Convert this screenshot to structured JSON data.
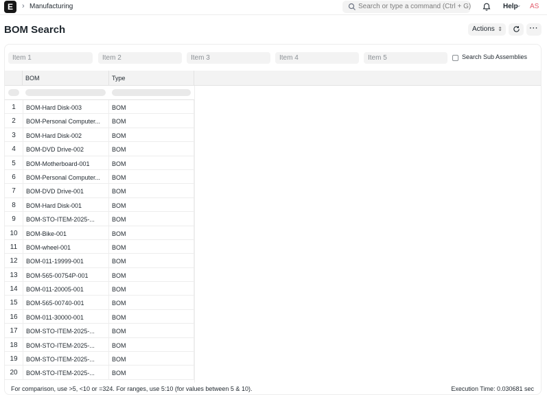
{
  "navbar": {
    "logo": "E",
    "breadcrumb": "Manufacturing",
    "search_placeholder": "Search or type a command (Ctrl + G)",
    "help_label": "Help",
    "avatar_initials": "AS"
  },
  "page": {
    "title": "BOM Search",
    "actions_label": "Actions",
    "refresh_icon": "refresh-icon",
    "more_label": "···"
  },
  "filters": {
    "item1": "Item 1",
    "item2": "Item 2",
    "item3": "Item 3",
    "item4": "Item 4",
    "item5": "Item 5",
    "search_sub_assemblies": "Search Sub Assemblies",
    "search_sub_assemblies_checked": false
  },
  "table": {
    "columns": [
      "BOM",
      "Type"
    ],
    "rows": [
      {
        "no": "1",
        "bom": "BOM-Hard Disk-003",
        "type": "BOM"
      },
      {
        "no": "2",
        "bom": "BOM-Personal Computer...",
        "type": "BOM"
      },
      {
        "no": "3",
        "bom": "BOM-Hard Disk-002",
        "type": "BOM"
      },
      {
        "no": "4",
        "bom": "BOM-DVD Drive-002",
        "type": "BOM"
      },
      {
        "no": "5",
        "bom": "BOM-Motherboard-001",
        "type": "BOM"
      },
      {
        "no": "6",
        "bom": "BOM-Personal Computer...",
        "type": "BOM"
      },
      {
        "no": "7",
        "bom": "BOM-DVD Drive-001",
        "type": "BOM"
      },
      {
        "no": "8",
        "bom": "BOM-Hard Disk-001",
        "type": "BOM"
      },
      {
        "no": "9",
        "bom": "BOM-STO-ITEM-2025-...",
        "type": "BOM"
      },
      {
        "no": "10",
        "bom": "BOM-Bike-001",
        "type": "BOM"
      },
      {
        "no": "11",
        "bom": "BOM-wheel-001",
        "type": "BOM"
      },
      {
        "no": "12",
        "bom": "BOM-011-19999-001",
        "type": "BOM"
      },
      {
        "no": "13",
        "bom": "BOM-565-00754P-001",
        "type": "BOM"
      },
      {
        "no": "14",
        "bom": "BOM-011-20005-001",
        "type": "BOM"
      },
      {
        "no": "15",
        "bom": "BOM-565-00740-001",
        "type": "BOM"
      },
      {
        "no": "16",
        "bom": "BOM-011-30000-001",
        "type": "BOM"
      },
      {
        "no": "17",
        "bom": "BOM-STO-ITEM-2025-...",
        "type": "BOM"
      },
      {
        "no": "18",
        "bom": "BOM-STO-ITEM-2025-...",
        "type": "BOM"
      },
      {
        "no": "19",
        "bom": "BOM-STO-ITEM-2025-...",
        "type": "BOM"
      },
      {
        "no": "20",
        "bom": "BOM-STO-ITEM-2025-...",
        "type": "BOM"
      }
    ]
  },
  "footer": {
    "note": "For comparison, use >5, <10 or =324. For ranges, use 5:10 (for values between 5 & 10).",
    "execution_time": "Execution Time: 0.030681 sec"
  }
}
